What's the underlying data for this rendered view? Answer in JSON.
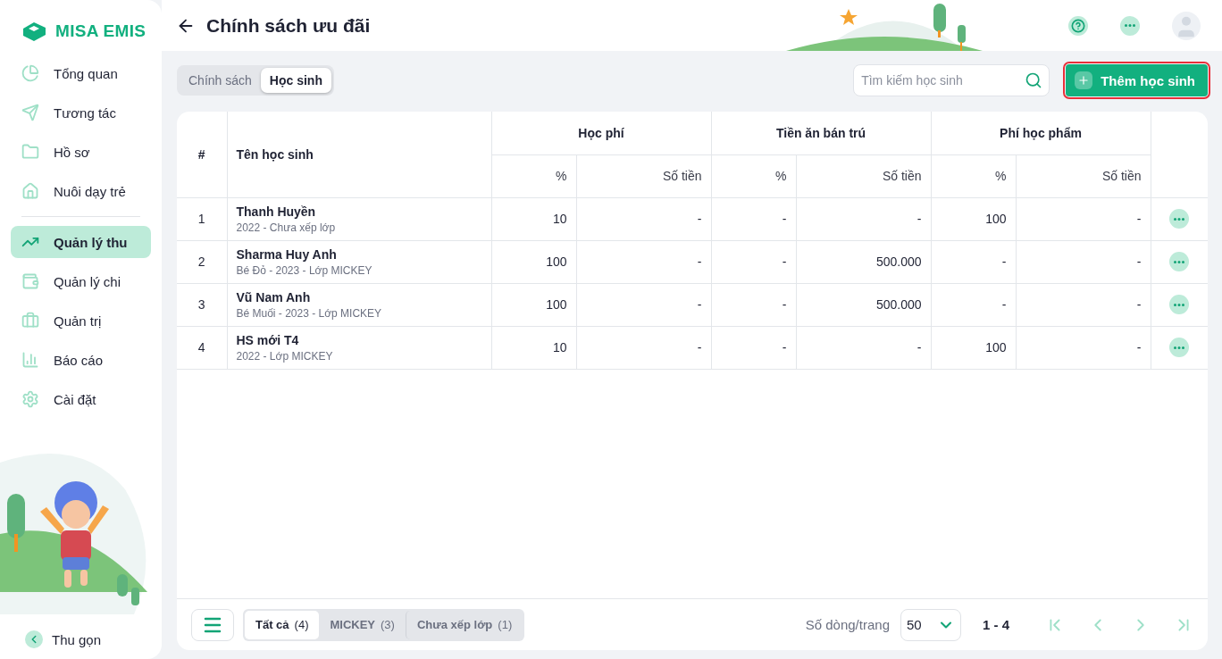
{
  "brand": {
    "name": "MISA EMIS"
  },
  "sidebar": {
    "items": [
      {
        "label": "Tổng quan",
        "selected": false
      },
      {
        "label": "Tương tác",
        "selected": false
      },
      {
        "label": "Hồ sơ",
        "selected": false
      },
      {
        "label": "Nuôi dạy trẻ",
        "selected": false
      },
      {
        "label": "Quản lý thu",
        "selected": true
      },
      {
        "label": "Quản lý chi",
        "selected": false
      },
      {
        "label": "Quản trị",
        "selected": false
      },
      {
        "label": "Báo cáo",
        "selected": false
      },
      {
        "label": "Cài đặt",
        "selected": false
      }
    ],
    "collapse_label": "Thu gọn"
  },
  "header": {
    "title": "Chính sách ưu đãi"
  },
  "tabs": [
    {
      "label": "Chính sách",
      "selected": false
    },
    {
      "label": "Học sinh",
      "selected": true
    }
  ],
  "search": {
    "placeholder": "Tìm kiếm học sinh"
  },
  "add_button": {
    "label": "Thêm học sinh",
    "highlighted": true
  },
  "table": {
    "index_header": "#",
    "name_header": "Tên học sinh",
    "groups": [
      {
        "label": "Học phí",
        "columns": [
          "%",
          "Số tiền"
        ]
      },
      {
        "label": "Tiền ăn bán trú",
        "columns": [
          "%",
          "Số tiền"
        ]
      },
      {
        "label": "Phí học phẩm",
        "columns": [
          "%",
          "Số tiền"
        ]
      }
    ],
    "rows": [
      {
        "index": "1",
        "name": "Thanh Huyền",
        "detail": "2022 - Chưa xếp lớp",
        "values": [
          "10",
          "-",
          "-",
          "-",
          "100",
          "-"
        ]
      },
      {
        "index": "2",
        "name": "Sharma Huy Anh",
        "detail": "Bé Đỏ - 2023 - Lớp MICKEY",
        "values": [
          "100",
          "-",
          "-",
          "500.000",
          "-",
          "-"
        ]
      },
      {
        "index": "3",
        "name": "Vũ Nam Anh",
        "detail": "Bé Muối - 2023 - Lớp MICKEY",
        "values": [
          "100",
          "-",
          "-",
          "500.000",
          "-",
          "-"
        ]
      },
      {
        "index": "4",
        "name": "HS mới T4",
        "detail": "2022 - Lớp MICKEY",
        "values": [
          "10",
          "-",
          "-",
          "-",
          "100",
          "-"
        ]
      }
    ]
  },
  "filters": [
    {
      "label": "Tất cả",
      "count": "(4)",
      "selected": true
    },
    {
      "label": "MICKEY",
      "count": "(3)",
      "selected": false
    },
    {
      "label": "Chưa xếp lớp",
      "count": "(1)",
      "selected": false
    }
  ],
  "pagination": {
    "rows_label": "Số dòng/trang",
    "page_size": "50",
    "range": "1 - 4",
    "buttons": [
      {
        "kind": "first",
        "disabled": true
      },
      {
        "kind": "prev",
        "disabled": true
      },
      {
        "kind": "next",
        "disabled": true
      },
      {
        "kind": "last",
        "disabled": true
      }
    ]
  }
}
